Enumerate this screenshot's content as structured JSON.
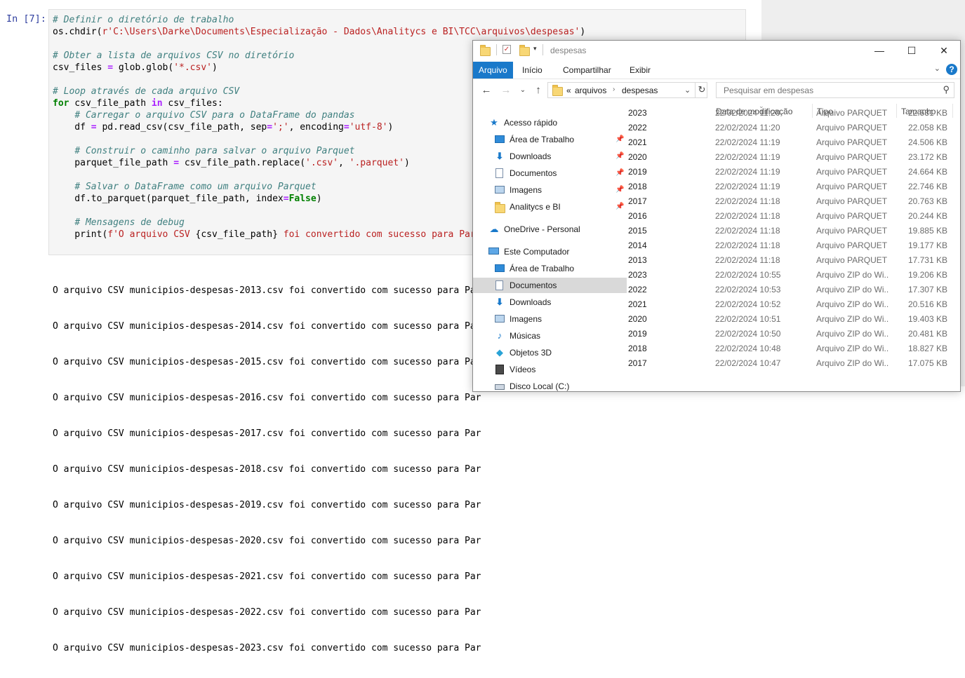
{
  "notebook": {
    "prompt": "In [7]:",
    "output_lines": [
      "O arquivo CSV municipios-despesas-2013.csv foi convertido com sucesso para Par",
      "O arquivo CSV municipios-despesas-2014.csv foi convertido com sucesso para Par",
      "O arquivo CSV municipios-despesas-2015.csv foi convertido com sucesso para Par",
      "O arquivo CSV municipios-despesas-2016.csv foi convertido com sucesso para Par",
      "O arquivo CSV municipios-despesas-2017.csv foi convertido com sucesso para Par",
      "O arquivo CSV municipios-despesas-2018.csv foi convertido com sucesso para Par",
      "O arquivo CSV municipios-despesas-2019.csv foi convertido com sucesso para Par",
      "O arquivo CSV municipios-despesas-2020.csv foi convertido com sucesso para Par",
      "O arquivo CSV municipios-despesas-2021.csv foi convertido com sucesso para Par",
      "O arquivo CSV municipios-despesas-2022.csv foi convertido com sucesso para Par",
      "O arquivo CSV municipios-despesas-2023.csv foi convertido com sucesso para Par"
    ]
  },
  "explorer": {
    "title": "despesas",
    "window_buttons": {
      "minimize": "—",
      "maximize": "☐",
      "close": "✕"
    },
    "ribbon_tabs": [
      "Arquivo",
      "Início",
      "Compartilhar",
      "Exibir"
    ],
    "help": "?",
    "address": {
      "prefix": "«",
      "crumbs": [
        "arquivos",
        "despesas"
      ]
    },
    "search_placeholder": "Pesquisar em despesas",
    "nav": [
      {
        "label": "Acesso rápido",
        "icon": "star-icon",
        "pinned": false
      },
      {
        "label": "Área de Trabalho",
        "icon": "desktop-icon",
        "pinned": true
      },
      {
        "label": "Downloads",
        "icon": "download-icon",
        "pinned": true
      },
      {
        "label": "Documentos",
        "icon": "document-icon",
        "pinned": true
      },
      {
        "label": "Imagens",
        "icon": "image-icon",
        "pinned": true
      },
      {
        "label": "Analitycs e BI",
        "icon": "folder-icon",
        "pinned": true
      },
      {
        "label": "OneDrive - Personal",
        "icon": "cloud-icon",
        "pinned": false
      },
      {
        "label": "Este Computador",
        "icon": "computer-icon",
        "pinned": false
      },
      {
        "label": "Área de Trabalho",
        "icon": "desktop-icon",
        "pinned": false
      },
      {
        "label": "Documentos",
        "icon": "document-icon",
        "pinned": false,
        "selected": true
      },
      {
        "label": "Downloads",
        "icon": "download-icon",
        "pinned": false
      },
      {
        "label": "Imagens",
        "icon": "image-icon",
        "pinned": false
      },
      {
        "label": "Músicas",
        "icon": "music-icon",
        "pinned": false
      },
      {
        "label": "Objetos 3D",
        "icon": "cube-icon",
        "pinned": false
      },
      {
        "label": "Vídeos",
        "icon": "video-icon",
        "pinned": false
      },
      {
        "label": "Disco Local (C:)",
        "icon": "drive-icon",
        "pinned": false
      }
    ],
    "columns": [
      "Data de modificação",
      "Tipo",
      "Tamanho"
    ],
    "files": [
      {
        "name": "2023",
        "date": "22/02/2024 11:20",
        "type": "Arquivo PARQUET",
        "size": "22.531 KB"
      },
      {
        "name": "2022",
        "date": "22/02/2024 11:20",
        "type": "Arquivo PARQUET",
        "size": "22.058 KB"
      },
      {
        "name": "2021",
        "date": "22/02/2024 11:19",
        "type": "Arquivo PARQUET",
        "size": "24.506 KB"
      },
      {
        "name": "2020",
        "date": "22/02/2024 11:19",
        "type": "Arquivo PARQUET",
        "size": "23.172 KB"
      },
      {
        "name": "2019",
        "date": "22/02/2024 11:19",
        "type": "Arquivo PARQUET",
        "size": "24.664 KB"
      },
      {
        "name": "2018",
        "date": "22/02/2024 11:19",
        "type": "Arquivo PARQUET",
        "size": "22.746 KB"
      },
      {
        "name": "2017",
        "date": "22/02/2024 11:18",
        "type": "Arquivo PARQUET",
        "size": "20.763 KB"
      },
      {
        "name": "2016",
        "date": "22/02/2024 11:18",
        "type": "Arquivo PARQUET",
        "size": "20.244 KB"
      },
      {
        "name": "2015",
        "date": "22/02/2024 11:18",
        "type": "Arquivo PARQUET",
        "size": "19.885 KB"
      },
      {
        "name": "2014",
        "date": "22/02/2024 11:18",
        "type": "Arquivo PARQUET",
        "size": "19.177 KB"
      },
      {
        "name": "2013",
        "date": "22/02/2024 11:18",
        "type": "Arquivo PARQUET",
        "size": "17.731 KB"
      },
      {
        "name": "2023",
        "date": "22/02/2024 10:55",
        "type": "Arquivo ZIP do Wi...",
        "size": "19.206 KB"
      },
      {
        "name": "2022",
        "date": "22/02/2024 10:53",
        "type": "Arquivo ZIP do Wi...",
        "size": "17.307 KB"
      },
      {
        "name": "2021",
        "date": "22/02/2024 10:52",
        "type": "Arquivo ZIP do Wi...",
        "size": "20.516 KB"
      },
      {
        "name": "2020",
        "date": "22/02/2024 10:51",
        "type": "Arquivo ZIP do Wi...",
        "size": "19.403 KB"
      },
      {
        "name": "2019",
        "date": "22/02/2024 10:50",
        "type": "Arquivo ZIP do Wi...",
        "size": "20.481 KB"
      },
      {
        "name": "2018",
        "date": "22/02/2024 10:48",
        "type": "Arquivo ZIP do Wi...",
        "size": "18.827 KB"
      },
      {
        "name": "2017",
        "date": "22/02/2024 10:47",
        "type": "Arquivo ZIP do Wi...",
        "size": "17.075 KB"
      }
    ]
  }
}
